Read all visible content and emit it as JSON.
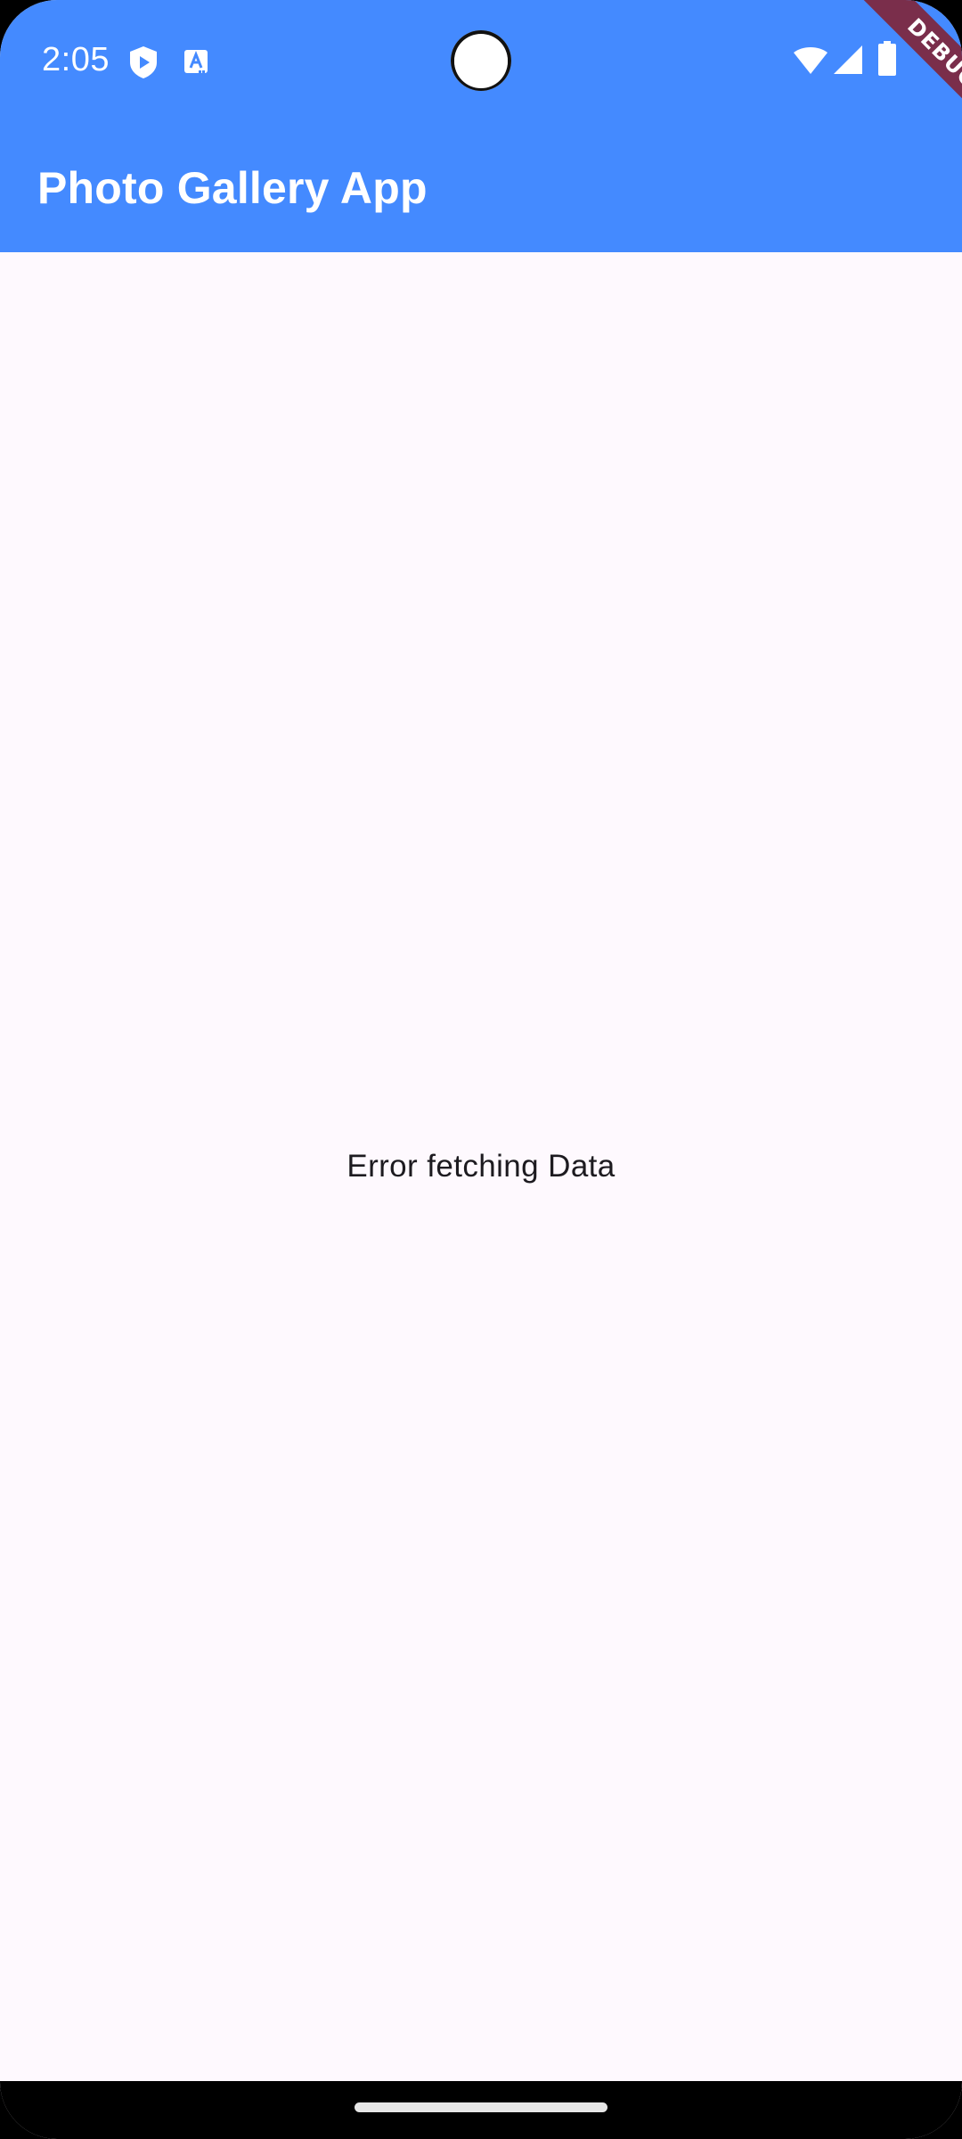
{
  "status_bar": {
    "time": "2:05",
    "background_color": "#448AFF",
    "left_icons": [
      "play-protect-icon",
      "translate-icon"
    ],
    "right_icons": [
      "wifi-icon",
      "cellular-signal-icon",
      "battery-icon"
    ]
  },
  "app_bar": {
    "title": "Photo Gallery App",
    "background_color": "#448AFF"
  },
  "content": {
    "message": "Error fetching Data",
    "background_color": "#FEF9FE"
  },
  "debug_banner": {
    "label": "DEBUG",
    "color": "#7A2E4B"
  }
}
